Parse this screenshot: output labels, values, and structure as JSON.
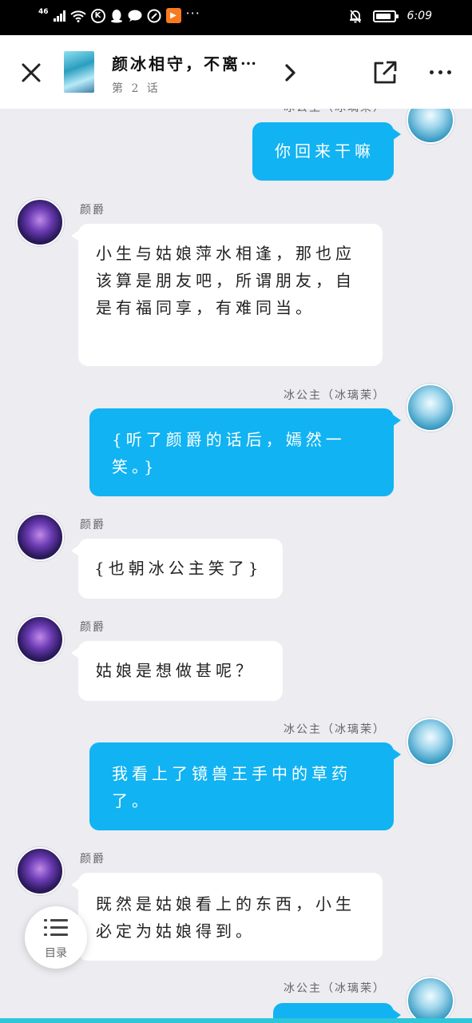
{
  "status_bar": {
    "network": "46",
    "app_icon_k": "K",
    "app_icon_play": "▶",
    "more_dots": "···",
    "time": "6:09",
    "battery_level": 0.9
  },
  "header": {
    "close_icon": "close-icon",
    "title": "颜冰相守，不离⋯",
    "chapter": "第 2 话",
    "next_icon": "chevron-right-icon",
    "share_icon": "share-icon",
    "more_icon": "more-icon"
  },
  "messages": [
    {
      "side": "right",
      "speaker": "冰公主（冰璃茉）",
      "text": "你回来干嘛",
      "avatar": "ice-princess-avatar"
    },
    {
      "side": "left",
      "speaker": "颜爵",
      "text": "小生与姑娘萍水相逢，那也应该算是朋友吧，所谓朋友，自是有福同享，有难同当。",
      "avatar": "yanjue-avatar"
    },
    {
      "side": "right",
      "speaker": "冰公主（冰璃茉）",
      "text": "{听了颜爵的话后，嫣然一笑。}",
      "avatar": "ice-princess-avatar"
    },
    {
      "side": "left",
      "speaker": "颜爵",
      "text": "{也朝冰公主笑了}",
      "avatar": "yanjue-avatar"
    },
    {
      "side": "left",
      "speaker": "颜爵",
      "text": "姑娘是想做甚呢？",
      "avatar": "yanjue-avatar"
    },
    {
      "side": "right",
      "speaker": "冰公主（冰璃茉）",
      "text": "我看上了镜兽王手中的草药了。",
      "avatar": "ice-princess-avatar"
    },
    {
      "side": "left",
      "speaker": "颜爵",
      "text": "既然是姑娘看上的东西，小生必定为姑娘得到。",
      "avatar": "yanjue-avatar"
    },
    {
      "side": "right",
      "speaker": "冰公主（冰璃茉）",
      "text": "",
      "avatar": "ice-princess-avatar"
    }
  ],
  "toc": {
    "label": "目录",
    "icon": "list-icon"
  },
  "colors": {
    "accent": "#11b3f2",
    "background": "#ececf1",
    "bubble_left": "#ffffff",
    "strip": "#2fc6d9"
  }
}
